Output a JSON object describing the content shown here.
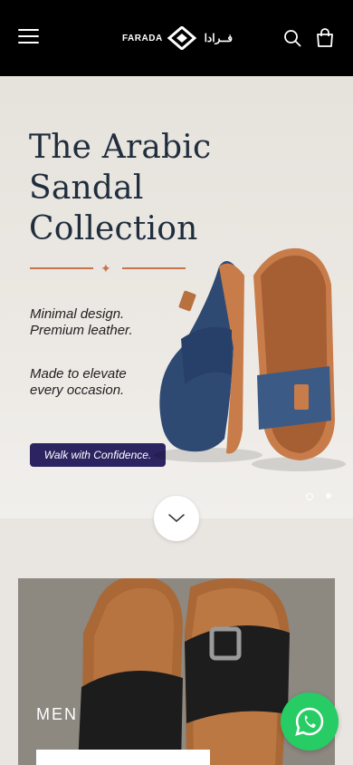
{
  "header": {
    "brand_latin": "FARADA",
    "brand_arabic": "فــرادا",
    "menu_icon": "hamburger-icon",
    "search_icon": "search-icon",
    "cart_icon": "shopping-bag-icon"
  },
  "hero": {
    "title_line1": "The Arabic",
    "title_line2": "Sandal",
    "title_line3": "Collection",
    "tagline_line1": "Minimal design.",
    "tagline_line2": "Premium leather.",
    "tagline2_line1": "Made to elevate",
    "tagline2_line2": "every occasion.",
    "cta_label": "Walk with Confidence."
  },
  "category": {
    "label": "MEN"
  },
  "colors": {
    "header_bg": "#000000",
    "title_navy": "#1f2d3d",
    "accent_copper": "#c8744a",
    "cta_bg": "#2b2460",
    "whatsapp_green": "#27cc64"
  }
}
